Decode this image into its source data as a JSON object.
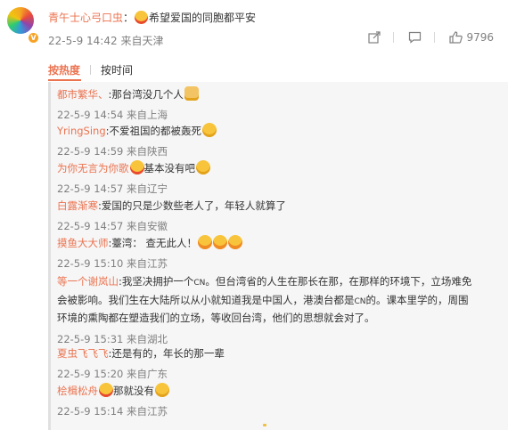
{
  "top_comment": {
    "author": "青午士心弓口虫",
    "separator": "：",
    "text": "希望爱国的同胞都平安",
    "time": "22-5-9 14:42",
    "source": "来自天津",
    "like_count": "9796",
    "icons": [
      "share-icon",
      "comment-icon",
      "like-icon"
    ]
  },
  "tabs": {
    "hot": "按热度",
    "time": "按时间"
  },
  "replies": [
    {
      "author": "都市繁华、",
      "text": ":那台湾没几个人",
      "emoji": "cat",
      "time": "22-5-9 14:54",
      "source": "来自上海"
    },
    {
      "author": "YringSing",
      "text": ":不爱祖国的都被轰死",
      "emoji": "smile",
      "time": "22-5-9 14:59",
      "source": "来自陕西"
    },
    {
      "author": "为你无言为你歌",
      "text": "基本没有吧",
      "emoji": "shy",
      "time": "22-5-9 14:57",
      "source": "来自辽宁"
    },
    {
      "author": "白露渐寒",
      "text": ":爱国的只是少数些老人了，年轻人就算了",
      "emoji": "",
      "time": "22-5-9 14:57",
      "source": "来自安徽"
    },
    {
      "author": "摸鱼大大师",
      "text": ":薹湾： 查无此人！",
      "emoji": "scream",
      "time": "22-5-9 15:10",
      "source": "来自江苏"
    },
    {
      "author": "等一个谢岚山",
      "text_line1": ":我坚决拥护一个",
      "cn1": "CN",
      "text_line1b": "。但台湾省的人生在那长在那，在那样的环境下，立场难免",
      "text_line2": "会被影响。我们生在大陆所以从小就知道我是中国人，港澳台都是",
      "cn2": "CN",
      "text_line2b": "的。课本里学的，周围",
      "text_line3": "环境的熏陶都在塑造我们的立场，等收回台湾，他们的思想就会对了。",
      "time": "22-5-9 15:31",
      "source": "来自湖北"
    },
    {
      "author": "夏虫飞飞飞",
      "text": ":还是有的，年长的那一辈",
      "emoji": "",
      "time": "22-5-9 15:20",
      "source": "来自广东"
    },
    {
      "author": "桧楫松舟",
      "text": "那就没有",
      "emoji": "laugh",
      "time": "22-5-9 15:14",
      "source": "来自江苏"
    }
  ]
}
